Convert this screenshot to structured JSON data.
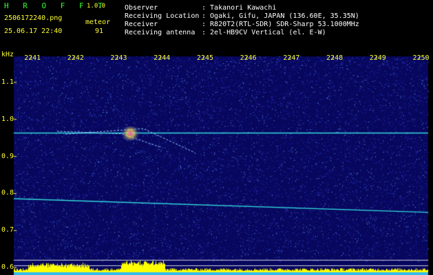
{
  "header": {
    "app_logo": "H R O F F T",
    "version": "1.0.0",
    "filename": "2506172240.png",
    "mode_label": "meteor",
    "datetime": "25.06.17 22:40",
    "count": "91",
    "fields": [
      {
        "label": "Observer",
        "value": ": Takanori Kawachi"
      },
      {
        "label": "Receiving Location",
        "value": ": Ogaki, Gifu, JAPAN (136.60E, 35.35N)"
      },
      {
        "label": "Receiver",
        "value": ": R820T2(RTL-SDR) SDR-Sharp 53.1000MHz"
      },
      {
        "label": "Receiving antenna",
        "value": ": 2el-HB9CV Vertical (el. E-W)"
      }
    ]
  },
  "colors": {
    "background": "#000000",
    "plot_background": "#07075e",
    "axis_text": "#ffff33",
    "header_text": "#ffffff",
    "logo": "#33ff33",
    "carrier_line": "#33dddd",
    "bottom_bar": "#ffff00"
  },
  "chart_data": {
    "type": "heatmap",
    "xaxis": {
      "label": "",
      "ticks": [
        "2241",
        "2242",
        "2243",
        "2244",
        "2245",
        "2246",
        "2247",
        "2248",
        "2249",
        "2250"
      ],
      "range": [
        2240.6,
        2250.2
      ]
    },
    "yaxis": {
      "label": "kHz",
      "ticks": [
        "1.1",
        "1.0",
        "0.9",
        "0.8",
        "0.7",
        "0.6"
      ],
      "range": [
        0.58,
        1.17
      ]
    },
    "traces": [
      {
        "kind": "carrier",
        "x": [
          2240.6,
          2250.2
        ],
        "y": [
          0.963,
          0.963
        ]
      },
      {
        "kind": "carrier",
        "x": [
          2240.6,
          2250.2
        ],
        "y": [
          0.786,
          0.749
        ]
      },
      {
        "kind": "meteor",
        "x": [
          2241.6,
          2243.1,
          2244.0
        ],
        "y": [
          0.968,
          0.961,
          0.925
        ]
      },
      {
        "kind": "meteor",
        "x": [
          2241.8,
          2243.6,
          2244.8
        ],
        "y": [
          0.96,
          0.975,
          0.91
        ]
      }
    ],
    "grid": false
  }
}
